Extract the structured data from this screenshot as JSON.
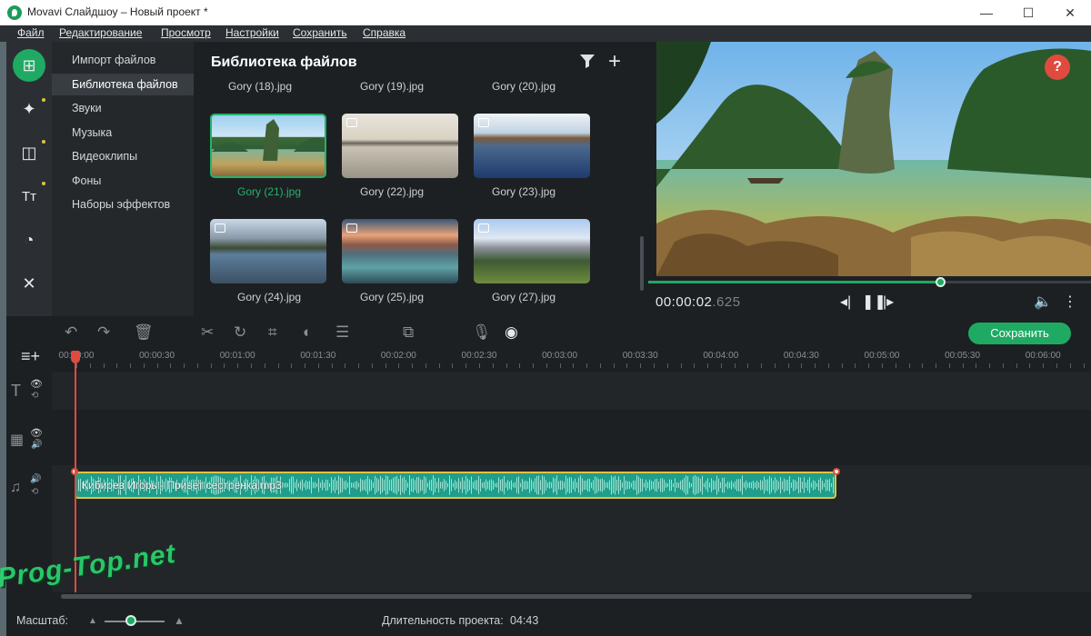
{
  "window": {
    "title": "Movavi Слайдшоу – Новый проект *",
    "minimize": "—",
    "maximize": "☐",
    "close": "✕"
  },
  "menu": [
    "Файл",
    "Редактирование",
    "Просмотр",
    "Настройки",
    "Сохранить",
    "Справка"
  ],
  "rail": [
    {
      "icon": "import-icon",
      "glyph": "⊞",
      "active": true
    },
    {
      "icon": "magic-wand-icon",
      "glyph": "✦",
      "active": false
    },
    {
      "icon": "transitions-icon",
      "glyph": "◫",
      "active": false
    },
    {
      "icon": "titles-icon",
      "glyph": "Tт",
      "active": false
    },
    {
      "icon": "filters-icon",
      "glyph": "◔",
      "active": false
    },
    {
      "icon": "tools-icon",
      "glyph": "✕",
      "active": false
    }
  ],
  "categories": [
    "Импорт файлов",
    "Библиотека файлов",
    "Звуки",
    "Музыка",
    "Видеоклипы",
    "Фоны",
    "Наборы эффектов"
  ],
  "active_category": "Библиотека файлов",
  "library": {
    "title": "Библиотека файлов",
    "top_labels": [
      "Gory (18).jpg",
      "Gory (19).jpg",
      "Gory (20).jpg"
    ],
    "items": [
      {
        "label": "Gory (21).jpg",
        "selected": true
      },
      {
        "label": "Gory (22).jpg",
        "selected": false
      },
      {
        "label": "Gory (23).jpg",
        "selected": false
      },
      {
        "label": "Gory (24).jpg",
        "selected": false
      },
      {
        "label": "Gory (25).jpg",
        "selected": false
      },
      {
        "label": "Gory (27).jpg",
        "selected": false
      }
    ]
  },
  "preview": {
    "help": "?",
    "time_main": "00:00:02",
    "time_ms": ".625",
    "progress": 0.66
  },
  "toolbar": {
    "save_label": "Сохранить"
  },
  "timeline": {
    "ticks": [
      "00:00:00",
      "00:00:30",
      "00:01:00",
      "00:01:30",
      "00:02:00",
      "00:02:30",
      "00:03:00",
      "00:03:30",
      "00:04:00",
      "00:04:30",
      "00:05:00",
      "00:05:30",
      "00:06:00"
    ],
    "audio_clip_name": "Кибирев Игорь - Привет сестренка.mp3",
    "audio_start_sec": 0,
    "audio_end_sec": 283
  },
  "status": {
    "zoom_label": "Масштаб:",
    "duration_label": "Длительность проекта:",
    "duration_value": "04:43"
  },
  "watermark": "Prog-Top.net",
  "colors": {
    "accent": "#1faa64",
    "danger": "#e04b3f",
    "clip": "#1f9e8c",
    "clip_border": "#e7c13c"
  }
}
